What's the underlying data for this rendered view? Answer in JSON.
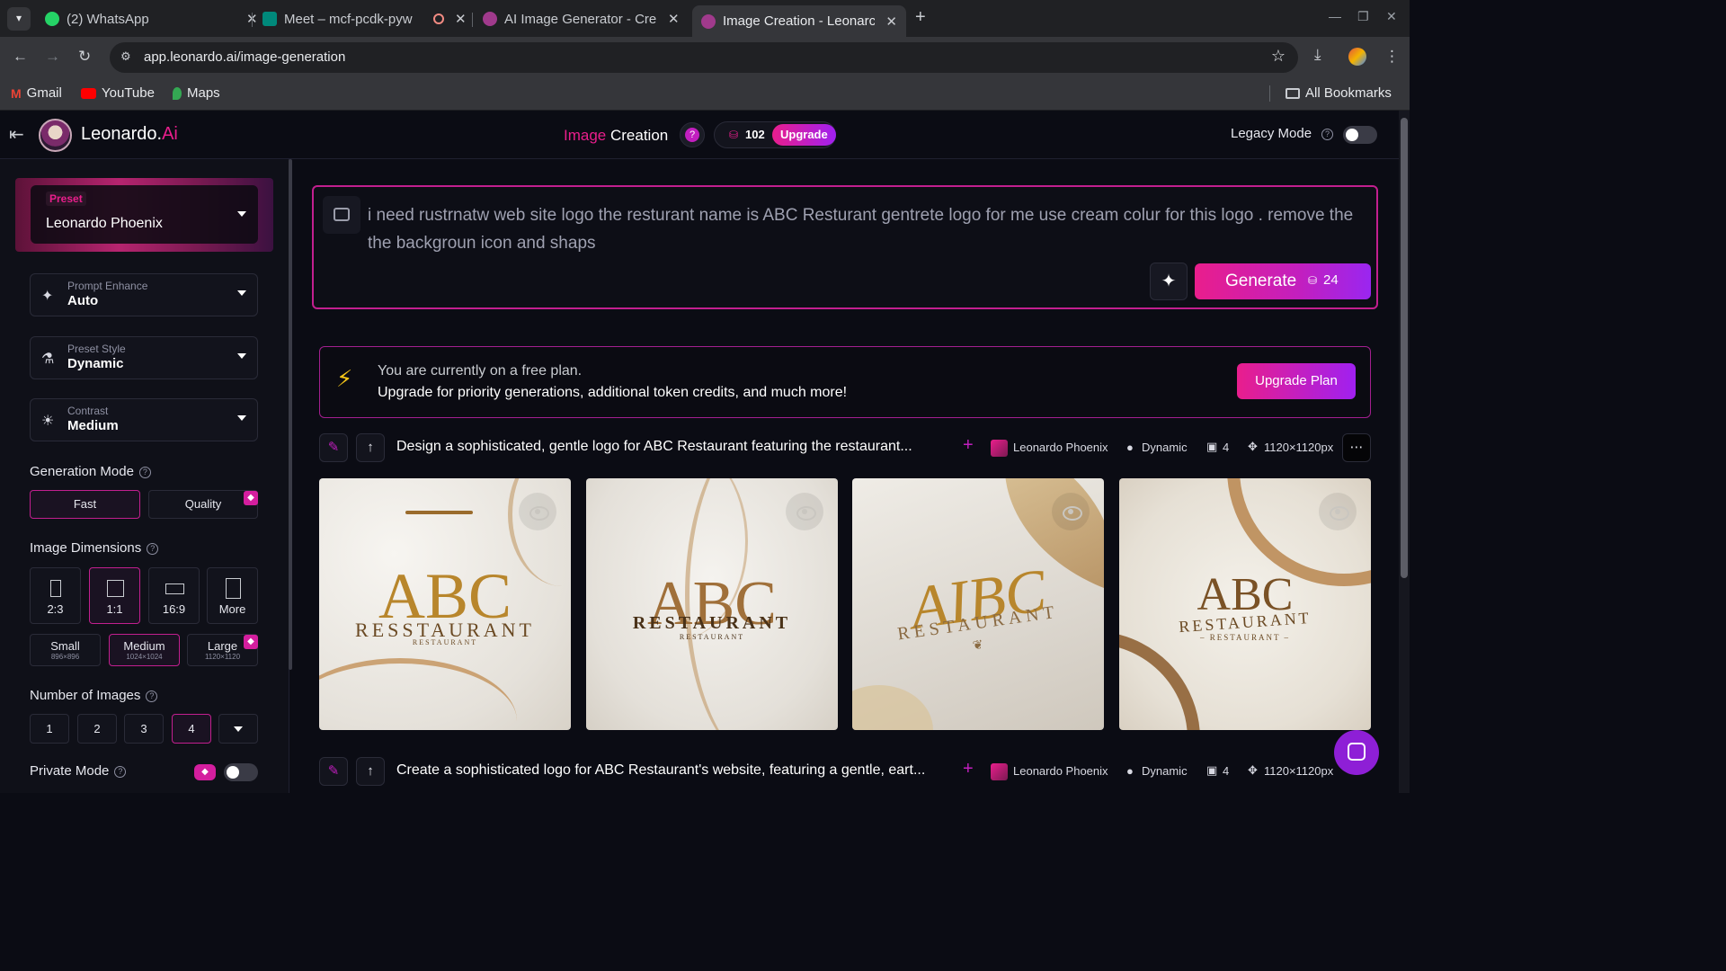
{
  "browser": {
    "tabs": [
      {
        "title": "(2) WhatsApp",
        "color": "#25d366"
      },
      {
        "title": "Meet – mcf-pcdk-pyw",
        "color": "#00897b"
      },
      {
        "title": "AI Image Generator - Cre",
        "color": "#a03a8c"
      },
      {
        "title": "Image Creation - Leonarc",
        "color": "#a03a8c"
      }
    ],
    "url": "app.leonardo.ai/image-generation",
    "bookmarks": [
      "Gmail",
      "YouTube",
      "Maps"
    ],
    "all_bookmarks": "All Bookmarks"
  },
  "header": {
    "brand": "Leonardo.",
    "brand_accent": "Ai",
    "title_accent": "Image",
    "title_rest": "Creation",
    "token_count": "102",
    "upgrade_label": "Upgrade",
    "legacy_label": "Legacy Mode"
  },
  "sidebar": {
    "preset_tag": "Preset",
    "preset_value": "Leonardo Phoenix",
    "prompt_enhance": {
      "label": "Prompt Enhance",
      "value": "Auto"
    },
    "preset_style": {
      "label": "Preset Style",
      "value": "Dynamic"
    },
    "contrast": {
      "label": "Contrast",
      "value": "Medium"
    },
    "generation_mode_label": "Generation Mode",
    "mode_fast": "Fast",
    "mode_quality": "Quality",
    "dimensions_label": "Image Dimensions",
    "ratios": [
      "2:3",
      "1:1",
      "16:9",
      "More"
    ],
    "sizes": [
      {
        "name": "Small",
        "px": "896×896"
      },
      {
        "name": "Medium",
        "px": "1024×1024"
      },
      {
        "name": "Large",
        "px": "1120×1120"
      }
    ],
    "num_images_label": "Number of Images",
    "num_options": [
      "1",
      "2",
      "3",
      "4"
    ],
    "private_label": "Private Mode"
  },
  "prompt": {
    "text": "i need rustrnatw web site logo the resturant name is ABC Resturant gentrete logo for me use cream colur for this logo . remove the the backgroun icon and shaps",
    "generate_label": "Generate",
    "generate_cost": "24"
  },
  "banner": {
    "line1": "You are currently on a free plan.",
    "line2": "Upgrade for priority generations, additional token credits, and much more!",
    "button": "Upgrade Plan"
  },
  "generations": [
    {
      "prompt": "Design a sophisticated, gentle logo for ABC Restaurant featuring the restaurant...",
      "model": "Leonardo Phoenix",
      "style": "Dynamic",
      "count": "4",
      "size": "1120×1120px"
    },
    {
      "prompt": "Create a sophisticated logo for ABC Restaurant's website, featuring a gentle, eart...",
      "model": "Leonardo Phoenix",
      "style": "Dynamic",
      "count": "4",
      "size": "1120×1120px"
    }
  ],
  "images": [
    {
      "big": "ABC",
      "small": "RESSTAURANT",
      "tiny": "RESTAURANT"
    },
    {
      "big": "ABC",
      "small": "RESTAURANT",
      "tiny": "RESTAURANT"
    },
    {
      "big": "AIBC",
      "small": "RESTAURANT",
      "tiny": ""
    },
    {
      "big": "ABC",
      "small": "RESTAURANT",
      "tiny": "– RESTAURANT –"
    }
  ],
  "colors": {
    "accent": "#e91e8c",
    "accent2": "#a020f0",
    "gold": "#b8862c"
  }
}
